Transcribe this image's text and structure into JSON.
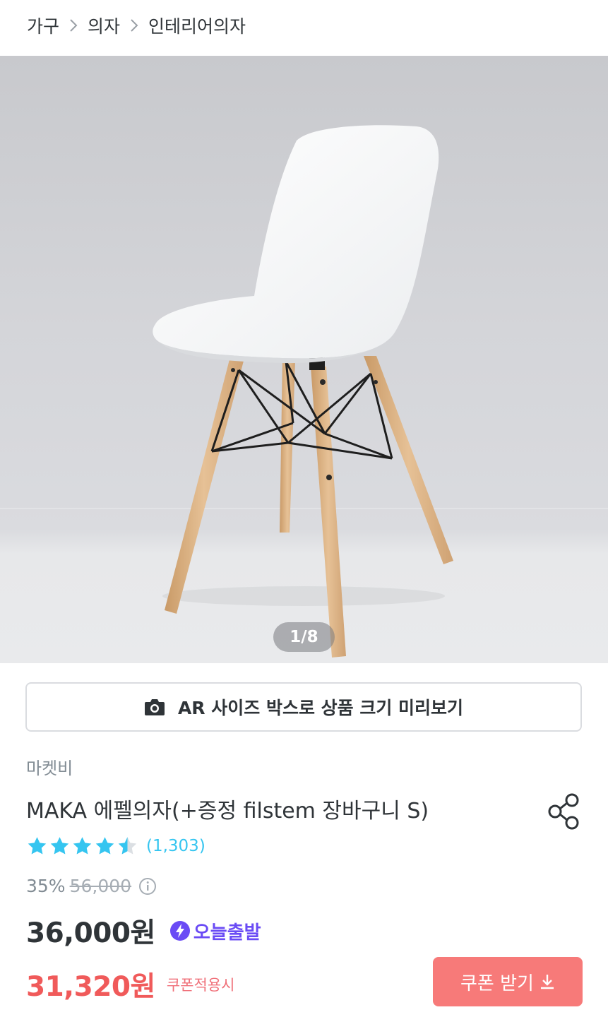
{
  "breadcrumb": [
    "가구",
    "의자",
    "인테리어의자"
  ],
  "gallery": {
    "counter": "1/8",
    "current": 1,
    "total": 8
  },
  "ar_button": {
    "label": "AR 사이즈 박스로 상품 크기 미리보기",
    "icon": "camera-icon"
  },
  "product": {
    "brand": "마켓비",
    "title": "MAKA 에펠의자(+증정 filstem 장바구니 S)",
    "rating": 4.5,
    "review_count": "(1,303)",
    "discount_rate": "35%",
    "original_price": "56,000",
    "price": "36,000원",
    "delivery_badge": "오늘출발",
    "coupon_price": "31,320원",
    "coupon_note": "쿠폰적용시"
  },
  "coupon_button": {
    "label": "쿠폰 받기",
    "icon": "download-icon"
  },
  "colors": {
    "accent": "#35c5f0",
    "coupon": "#f77a79",
    "coupon_price": "#f05a5a",
    "today_badge": "#6a4bf5"
  }
}
